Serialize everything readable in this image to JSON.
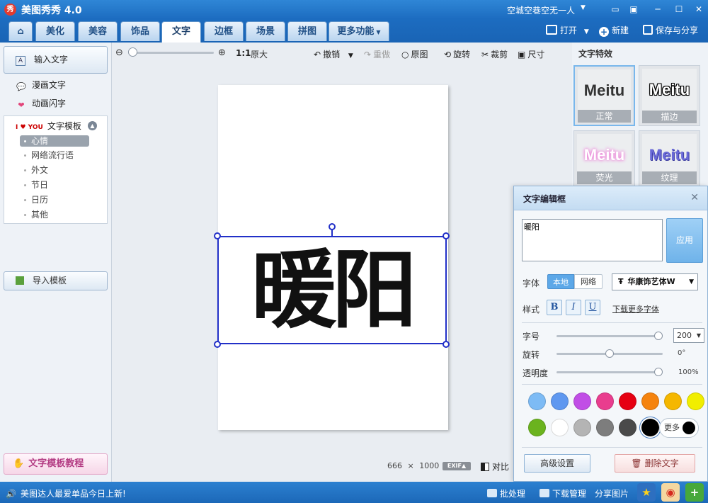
{
  "app": {
    "logo_text": "秀",
    "title": "美图秀秀 4.0"
  },
  "user": {
    "name": "空城空巷空无一人"
  },
  "tabs": [
    {
      "label": "美化"
    },
    {
      "label": "美容"
    },
    {
      "label": "饰品"
    },
    {
      "label": "文字",
      "active": true
    },
    {
      "label": "边框"
    },
    {
      "label": "场景"
    },
    {
      "label": "拼图"
    },
    {
      "label": "更多功能"
    }
  ],
  "top_actions": {
    "open": "打开",
    "new": "新建",
    "save_share": "保存与分享"
  },
  "left_panel": {
    "input_text": "输入文字",
    "comic_text": "漫画文字",
    "animated_text": "动画闪字",
    "template_head": "文字模板",
    "template_icon_text": "I ♥ YOU",
    "categories": [
      "心情",
      "网络流行语",
      "外文",
      "节日",
      "日历",
      "其他"
    ],
    "selected_category": "心情",
    "import_template": "导入模板",
    "tutorial": "文字模板教程"
  },
  "toolbar": {
    "ratio": "1:1",
    "original_size": "原大",
    "undo": "撤销",
    "redo": "重做",
    "original": "原图",
    "rotate": "旋转",
    "crop": "裁剪",
    "resize": "尺寸"
  },
  "canvas": {
    "text": "暖阳",
    "width_px": "666",
    "times": "×",
    "height_px": "1000",
    "exif": "EXIF▲",
    "compare": "对比"
  },
  "effects": {
    "title": "文字特效",
    "items": [
      {
        "preview": "Meitu",
        "label": "正常",
        "selected": true,
        "color": "#333333"
      },
      {
        "preview": "Meitu",
        "label": "描边",
        "color": "#000000"
      },
      {
        "preview": "Meitu",
        "label": "荧光",
        "color": "#f7b6e8"
      },
      {
        "preview": "Meitu",
        "label": "纹理",
        "color": "#6a6ad8"
      }
    ]
  },
  "editor": {
    "title": "文字编辑框",
    "text_value": "暖阳",
    "apply": "应用",
    "font_label": "字体",
    "font_local": "本地",
    "font_network": "网络",
    "font_icon": "Ŧ",
    "font_name": "华康饰艺体W",
    "style_label": "样式",
    "bold": "B",
    "italic": "I",
    "underline": "U",
    "download_fonts": "下载更多字体",
    "size_label": "字号",
    "size_value": "200",
    "size_fraction": 1.0,
    "rotate_label": "旋转",
    "rotate_value": "0°",
    "rotate_fraction": 0.5,
    "opacity_label": "透明度",
    "opacity_value": "100%",
    "opacity_fraction": 1.0,
    "colors_row1": [
      "#7dbbf5",
      "#5f98f0",
      "#c14ee6",
      "#e93d8e",
      "#e60012",
      "#f5830e",
      "#f5b700",
      "#f1ee00"
    ],
    "colors_row2": [
      "#6bb31e",
      "#ffffff",
      "#b4b4b4",
      "#7d7d7d",
      "#4a4a4a",
      "#000000"
    ],
    "selected_color": "#000000",
    "more_colors": "更多",
    "advanced": "高级设置",
    "delete_text": "删除文字"
  },
  "statusbar": {
    "news": "美图达人最爱单品今日上新!",
    "batch": "批处理",
    "download_manager": "下载管理",
    "share_image": "分享图片"
  }
}
